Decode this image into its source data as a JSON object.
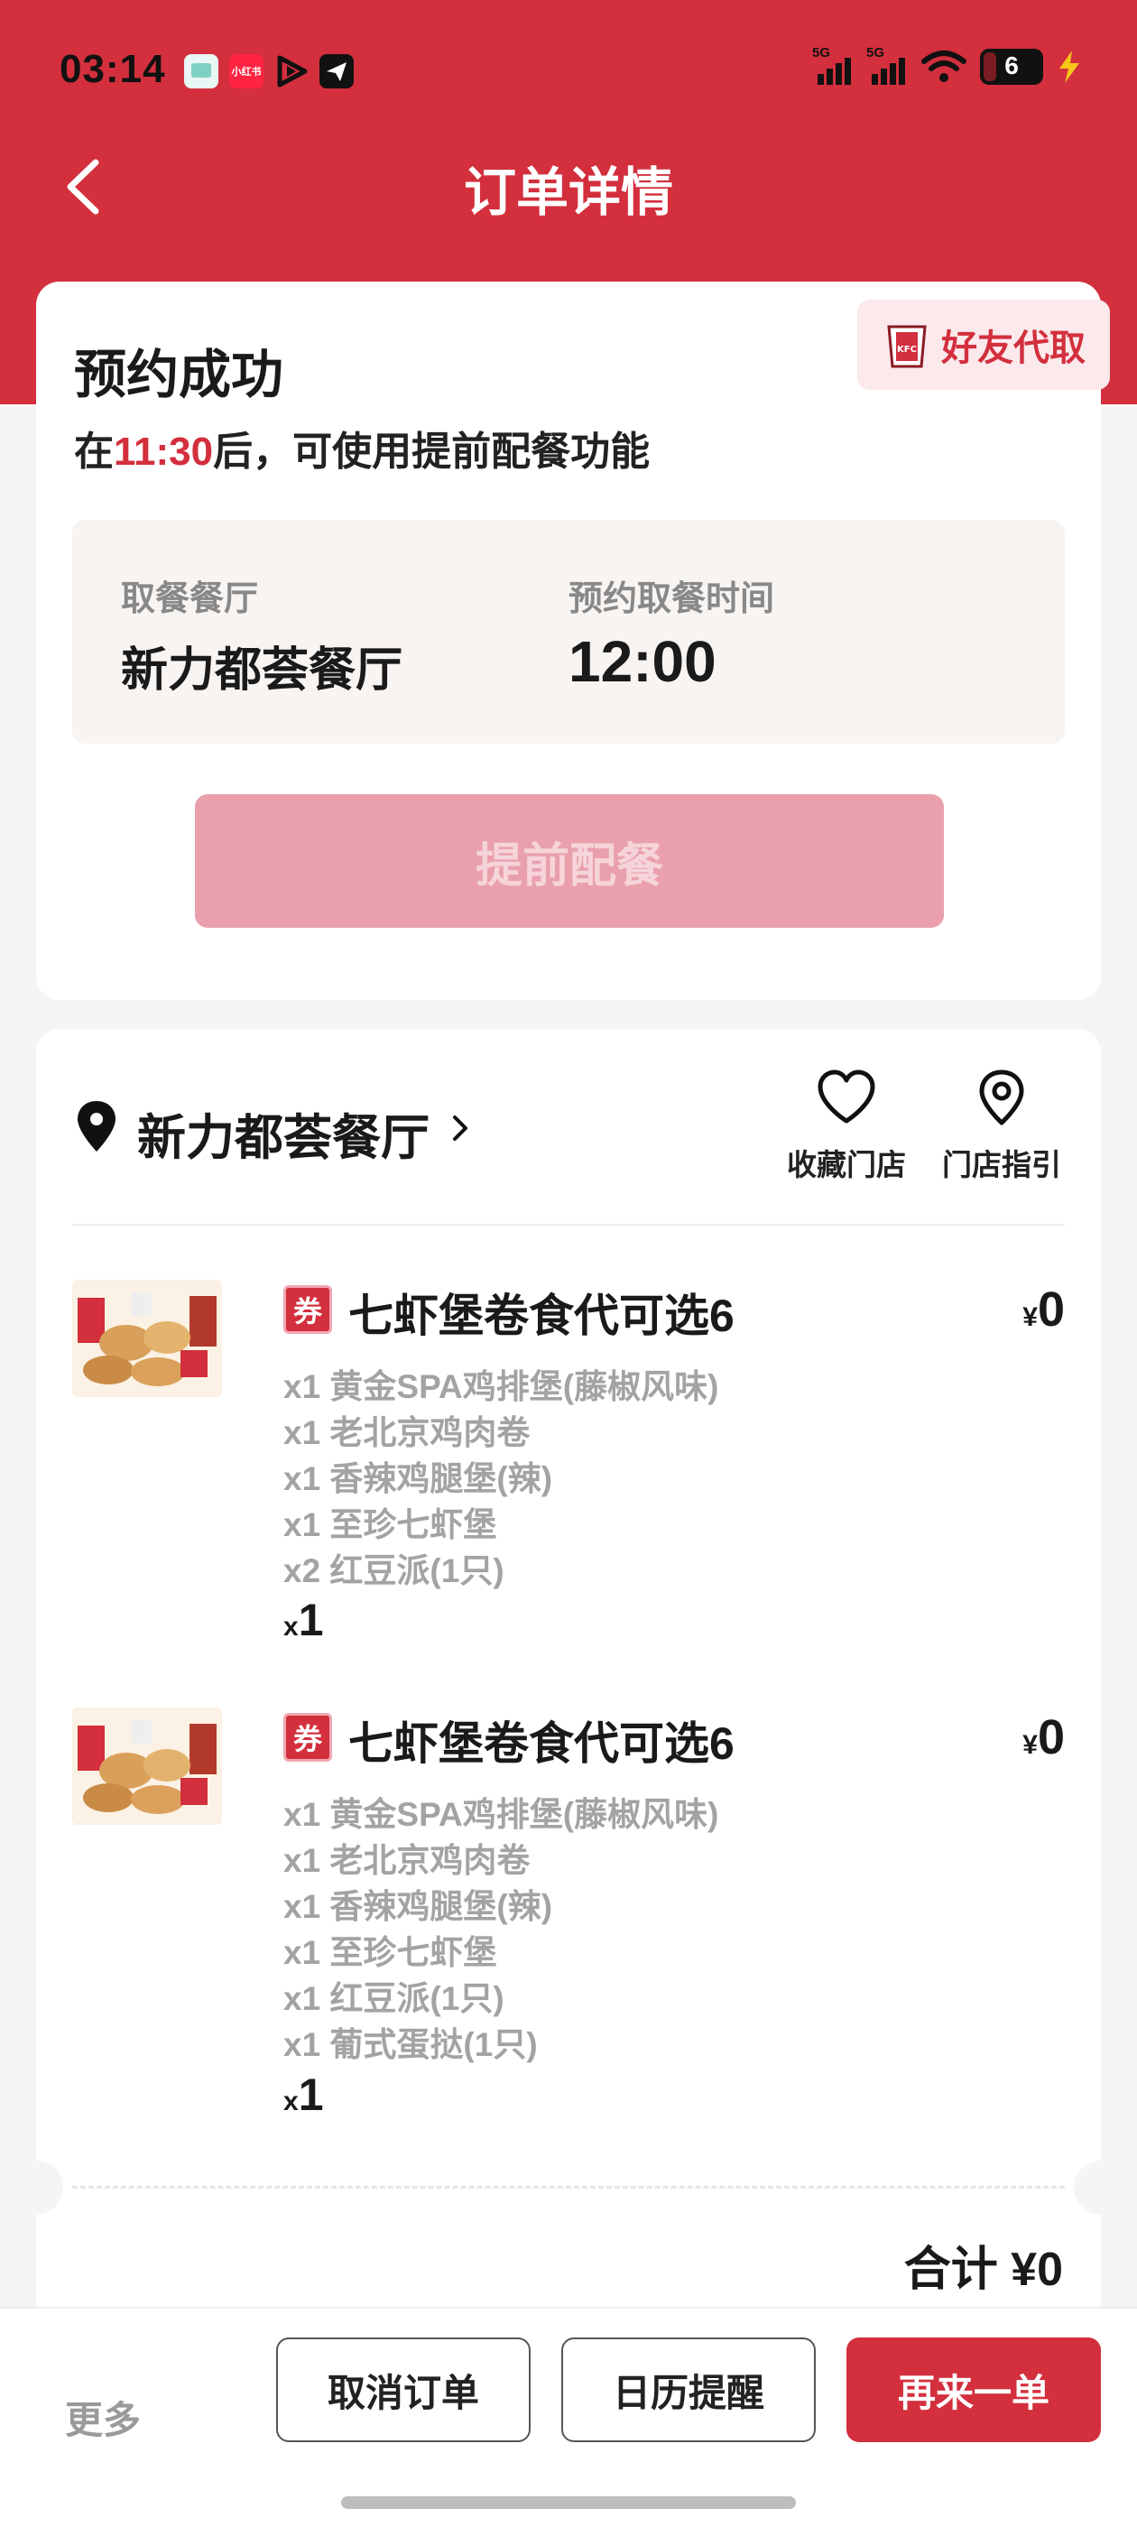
{
  "status_bar": {
    "time": "03:14",
    "apps": [
      {
        "icon": "messages-app-icon",
        "color": "#e8f6f4",
        "text": ""
      },
      {
        "icon": "xiaohongshu-app-icon",
        "color": "#ff2442",
        "text": "小红书"
      },
      {
        "icon": "video-play-app-icon",
        "color": "#111111",
        "text": ""
      },
      {
        "icon": "paper-plane-app-icon",
        "color": "#111111",
        "text": ""
      }
    ],
    "signal1_label": "5G",
    "signal2_label": "5G",
    "battery_level": "6"
  },
  "nav": {
    "title": "订单详情"
  },
  "order_status": {
    "share_label": "好友代取",
    "title": "预约成功",
    "desc_prefix": "在",
    "desc_time": "11:30",
    "desc_suffix": "后，可使用提前配餐功能",
    "restaurant_label": "取餐餐厅",
    "restaurant_value": "新力都荟餐厅",
    "pickup_label": "预约取餐时间",
    "pickup_value": "12:00",
    "prep_button": "提前配餐"
  },
  "store": {
    "name": "新力都荟餐厅",
    "favorite_label": "收藏门店",
    "guide_label": "门店指引"
  },
  "items": [
    {
      "coupon": "券",
      "name": "七虾堡卷食代可选6",
      "currency": "¥",
      "price": "0",
      "details": [
        "x1 黄金SPA鸡排堡(藤椒风味)",
        "x1 老北京鸡肉卷",
        "x1 香辣鸡腿堡(辣)",
        "x1 至珍七虾堡",
        "x2 红豆派(1只)"
      ],
      "qty_prefix": "x",
      "qty": "1"
    },
    {
      "coupon": "券",
      "name": "七虾堡卷食代可选6",
      "currency": "¥",
      "price": "0",
      "details": [
        "x1 黄金SPA鸡排堡(藤椒风味)",
        "x1 老北京鸡肉卷",
        "x1 香辣鸡腿堡(辣)",
        "x1 至珍七虾堡",
        "x1 红豆派(1只)",
        "x1 葡式蛋挞(1只)"
      ],
      "qty_prefix": "x",
      "qty": "1"
    }
  ],
  "summary": {
    "total": "合计 ¥0"
  },
  "bottom_bar": {
    "more": "更多",
    "cancel": "取消订单",
    "calendar": "日历提醒",
    "reorder": "再来一单"
  },
  "colors": {
    "brand_red": "#d32f3d",
    "button_disabled": "#e9a0ac"
  }
}
